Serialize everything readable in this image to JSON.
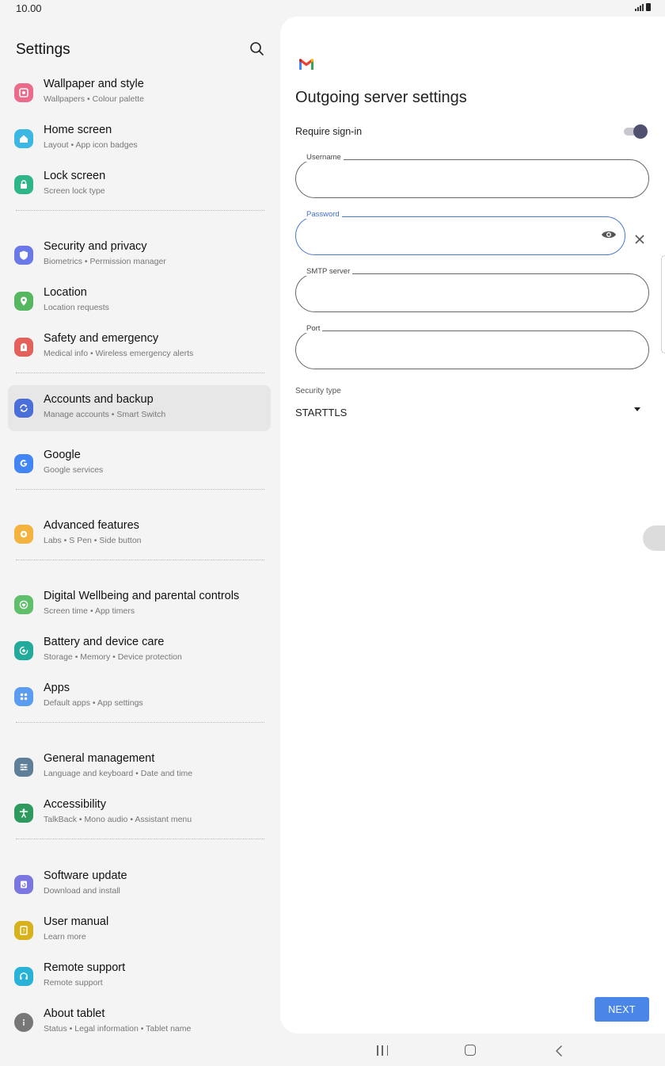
{
  "status_bar": {
    "time": "10.00"
  },
  "settings": {
    "title": "Settings",
    "items": [
      {
        "title": "Wallpaper and style",
        "subtitle": "Wallpapers  •  Colour palette",
        "icon": "wallpaper-icon",
        "color": "#ea6b8a"
      },
      {
        "title": "Home screen",
        "subtitle": "Layout  •  App icon badges",
        "icon": "home-icon",
        "color": "#3bb7e3"
      },
      {
        "title": "Lock screen",
        "subtitle": "Screen lock type",
        "icon": "lock-icon",
        "color": "#2fb58a"
      },
      {
        "title": "Security and privacy",
        "subtitle": "Biometrics  •  Permission manager",
        "icon": "shield-icon",
        "color": "#6b79e8"
      },
      {
        "title": "Location",
        "subtitle": "Location requests",
        "icon": "location-pin-icon",
        "color": "#56b760"
      },
      {
        "title": "Safety and emergency",
        "subtitle": "Medical info  •  Wireless emergency alerts",
        "icon": "emergency-icon",
        "color": "#e4605a"
      },
      {
        "title": "Accounts and backup",
        "subtitle": "Manage accounts  •  Smart Switch",
        "icon": "sync-icon",
        "color": "#4a6fd8"
      },
      {
        "title": "Google",
        "subtitle": "Google services",
        "icon": "google-icon",
        "color": "#4285f4"
      },
      {
        "title": "Advanced features",
        "subtitle": "Labs  •  S Pen  •  Side button",
        "icon": "gear-plus-icon",
        "color": "#f4b23e"
      },
      {
        "title": "Digital Wellbeing and parental controls",
        "subtitle": "Screen time  •  App timers",
        "icon": "wellbeing-icon",
        "color": "#5fbf6b"
      },
      {
        "title": "Battery and device care",
        "subtitle": "Storage  •  Memory  •  Device protection",
        "icon": "device-care-icon",
        "color": "#22aa9a"
      },
      {
        "title": "Apps",
        "subtitle": "Default apps  •  App settings",
        "icon": "apps-grid-icon",
        "color": "#5a9cf0"
      },
      {
        "title": "General management",
        "subtitle": "Language and keyboard  •  Date and time",
        "icon": "sliders-icon",
        "color": "#5f7e98"
      },
      {
        "title": "Accessibility",
        "subtitle": "TalkBack  •  Mono audio  •  Assistant menu",
        "icon": "accessibility-icon",
        "color": "#2e9a5e"
      },
      {
        "title": "Software update",
        "subtitle": "Download and install",
        "icon": "software-update-icon",
        "color": "#7a78e0"
      },
      {
        "title": "User manual",
        "subtitle": "Learn more",
        "icon": "manual-icon",
        "color": "#d8b21c"
      },
      {
        "title": "Remote support",
        "subtitle": "Remote support",
        "icon": "headset-icon",
        "color": "#28b2d8"
      },
      {
        "title": "About tablet",
        "subtitle": "Status  •  Legal information  •  Tablet name",
        "icon": "info-icon",
        "color": "#777777"
      }
    ]
  },
  "outgoing": {
    "app_icon": "gmail-logo-icon",
    "title": "Outgoing server settings",
    "require_signin_label": "Require sign-in",
    "require_signin_on": true,
    "fields": {
      "username": {
        "label": "Username",
        "value": ""
      },
      "password": {
        "label": "Password",
        "value": ""
      },
      "smtp": {
        "label": "SMTP server",
        "value": ""
      },
      "port": {
        "label": "Port",
        "value": ""
      }
    },
    "security_label": "Security type",
    "security_value": "STARTTLS",
    "next_label": "NEXT"
  },
  "colors": {
    "accent": "#4a86e8",
    "focus_border": "#4a78d0",
    "toggle_knob": "#505170"
  }
}
